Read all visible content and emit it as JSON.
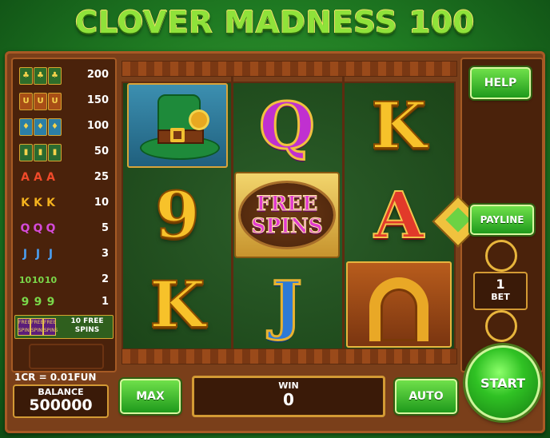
{
  "title": "CLOVER MADNESS 100",
  "paytable": [
    {
      "symbol": "hat",
      "glyphs": [
        "♣",
        "♣",
        "♣"
      ],
      "payout": "200"
    },
    {
      "symbol": "horseshoe",
      "glyphs": [
        "U",
        "U",
        "U"
      ],
      "payout": "150"
    },
    {
      "symbol": "hat-blue",
      "glyphs": [
        "♦",
        "♦",
        "♦"
      ],
      "payout": "100"
    },
    {
      "symbol": "bottle",
      "glyphs": [
        "▮",
        "▮",
        "▮"
      ],
      "payout": "50"
    },
    {
      "symbol": "AAA",
      "glyphs": [
        "A",
        "A",
        "A"
      ],
      "payout": "25"
    },
    {
      "symbol": "KKK",
      "glyphs": [
        "K",
        "K",
        "K"
      ],
      "payout": "10"
    },
    {
      "symbol": "QQQ",
      "glyphs": [
        "Q",
        "Q",
        "Q"
      ],
      "payout": "5"
    },
    {
      "symbol": "JJJ",
      "glyphs": [
        "J",
        "J",
        "J"
      ],
      "payout": "3"
    },
    {
      "symbol": "101010",
      "glyphs": [
        "10",
        "10",
        "10"
      ],
      "payout": "2"
    },
    {
      "symbol": "999",
      "glyphs": [
        "9",
        "9",
        "9"
      ],
      "payout": "1"
    }
  ],
  "paytable_free_spins": {
    "label_line1": "10 FREE",
    "label_line2": "SPINS",
    "mini_text": "FREE SPINS"
  },
  "reels": {
    "r1": [
      "hat",
      "9",
      "K"
    ],
    "r2": [
      "Q",
      "FREE SPINS",
      "J"
    ],
    "r3": [
      "K",
      "A",
      "horseshoe"
    ]
  },
  "free_spins_symbol": {
    "line1": "FREE",
    "line2": "SPINS"
  },
  "buttons": {
    "help": "HELP",
    "payline": "PAYLINE",
    "max": "MAX",
    "auto": "AUTO",
    "start": "START"
  },
  "bet": {
    "value": "1",
    "label": "BET"
  },
  "credit_rate": "1CR = 0.01FUN",
  "balance": {
    "label": "BALANCE",
    "value": "500000"
  },
  "win": {
    "label": "WIN",
    "value": "0"
  },
  "colors": {
    "background": "#2a8c2b",
    "wood": "#7a3f1a",
    "button_green": "#3fbf2a",
    "gold": "#e8b53c"
  }
}
